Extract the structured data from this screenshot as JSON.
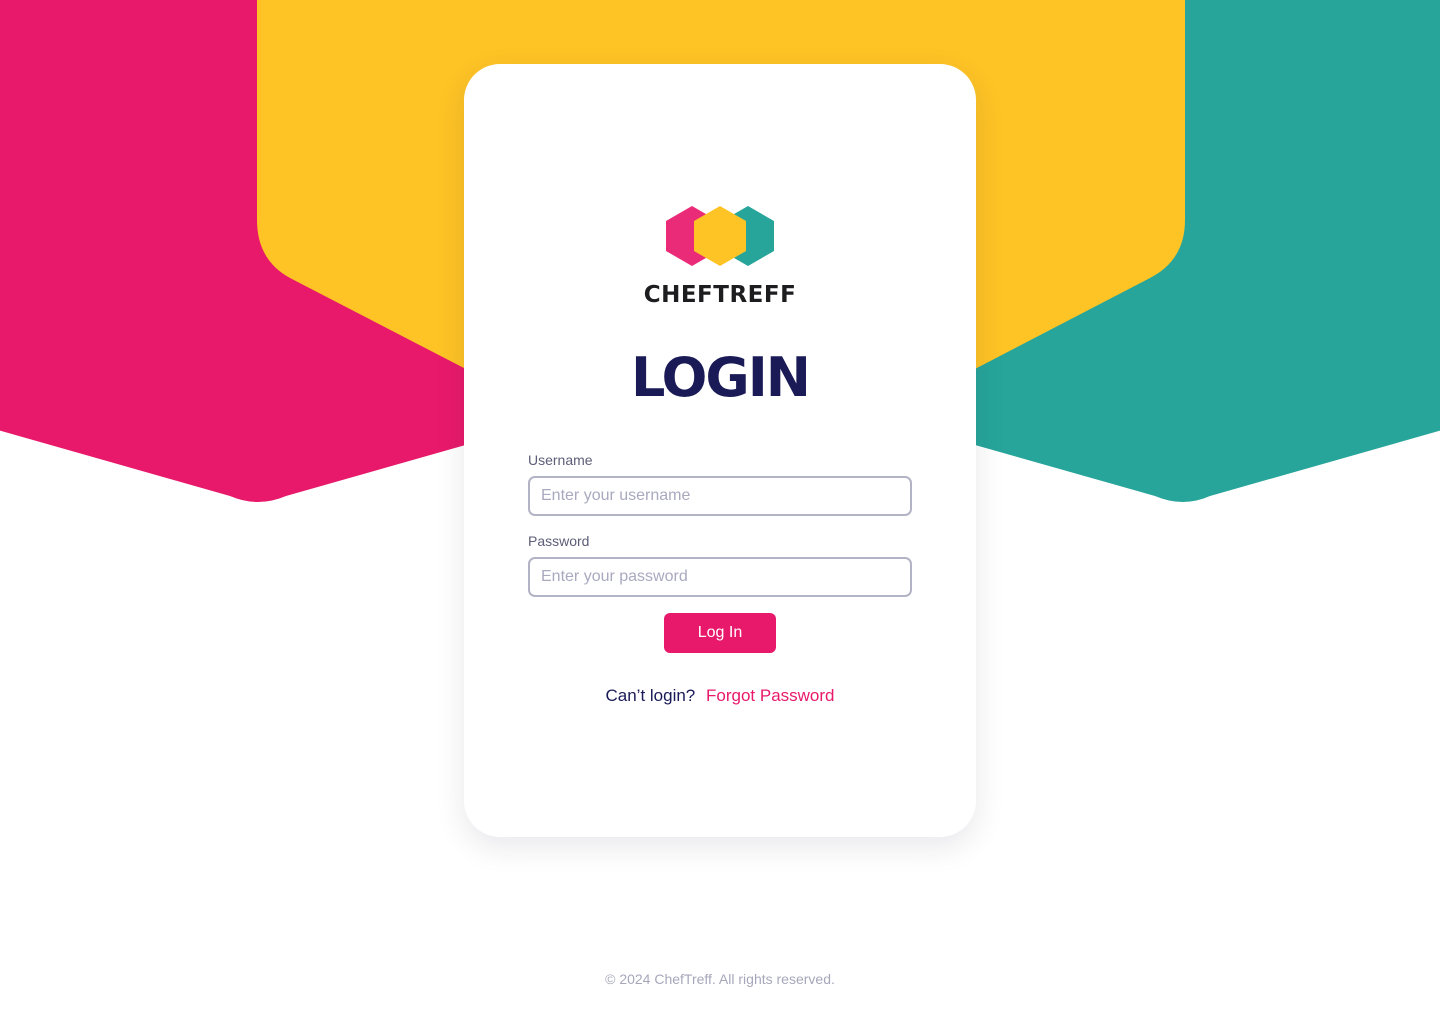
{
  "brand": {
    "name": "CHEFTREFF",
    "colors": {
      "pink": "#e8196b",
      "yellow": "#fec325",
      "teal": "#27a59a",
      "navy": "#1a1a57"
    },
    "logo_icon": "hexagon-cluster-logo"
  },
  "login": {
    "title": "LOGIN",
    "username_label": "Username",
    "username_placeholder": "Enter your username",
    "username_value": "",
    "password_label": "Password",
    "password_placeholder": "Enter your password",
    "password_value": "",
    "submit_label": "Log In",
    "help_text": "Can’t login?",
    "forgot_label": "Forgot Password"
  },
  "footer": {
    "copyright": "© 2024 ChefTreff. All rights reserved."
  }
}
